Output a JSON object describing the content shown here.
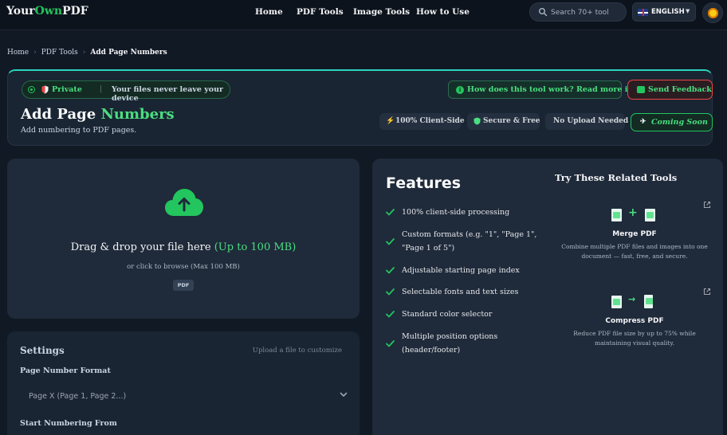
{
  "nav": {
    "logo_prefix": "Your",
    "logo_accent": "Own",
    "logo_suffix": "PDF",
    "links": [
      "Home",
      "PDF Tools",
      "Image Tools",
      "How to Use"
    ],
    "search_placeholder": "Search 70+ tool",
    "language": "ENGLISH"
  },
  "breadcrumb": [
    "Home",
    "PDF Tools",
    "Add Page Numbers"
  ],
  "hero": {
    "private_label": "Private",
    "private_msg": "Your files never leave your device",
    "how_label": "How does this tool work? Read more info",
    "feedback_label": "Send Feedback",
    "title_main": "Add Page",
    "title_accent": "Numbers",
    "subtitle": "Add numbering to PDF pages.",
    "pills": [
      "100% Client-Side",
      "Secure & Free",
      "No Upload Needed"
    ],
    "coming_soon": "Coming Soon"
  },
  "upload": {
    "title_main": "Drag & drop your file here",
    "title_accent": "(Up to 100 MB)",
    "sub": "or click to browse (Max 100 MB)",
    "badge": "PDF"
  },
  "settings": {
    "heading": "Settings",
    "hint": "Upload a file to customize",
    "format_label": "Page Number Format",
    "format_value": "Page X (Page 1, Page 2...)",
    "start_label": "Start Numbering From"
  },
  "features": {
    "heading": "Features",
    "items": [
      "100% client-side processing",
      "Custom formats (e.g. \"1\", \"Page 1\", \"Page 1 of 5\")",
      "Adjustable starting page index",
      "Selectable fonts and text sizes",
      "Standard color selector",
      "Multiple position options (header/footer)"
    ]
  },
  "related": {
    "heading": "Try These Related Tools",
    "tools": [
      {
        "name": "Merge PDF",
        "desc": "Combine multiple PDF files and images into one document — fast, free, and secure."
      },
      {
        "name": "Compress PDF",
        "desc": "Reduce PDF file size by up to 75% while maintaining visual quality."
      }
    ]
  },
  "colors": {
    "accent": "#22c55e",
    "accent_light": "#4ade80",
    "danger": "#ef4444",
    "background": "#111925",
    "card": "#1f2a3a"
  }
}
